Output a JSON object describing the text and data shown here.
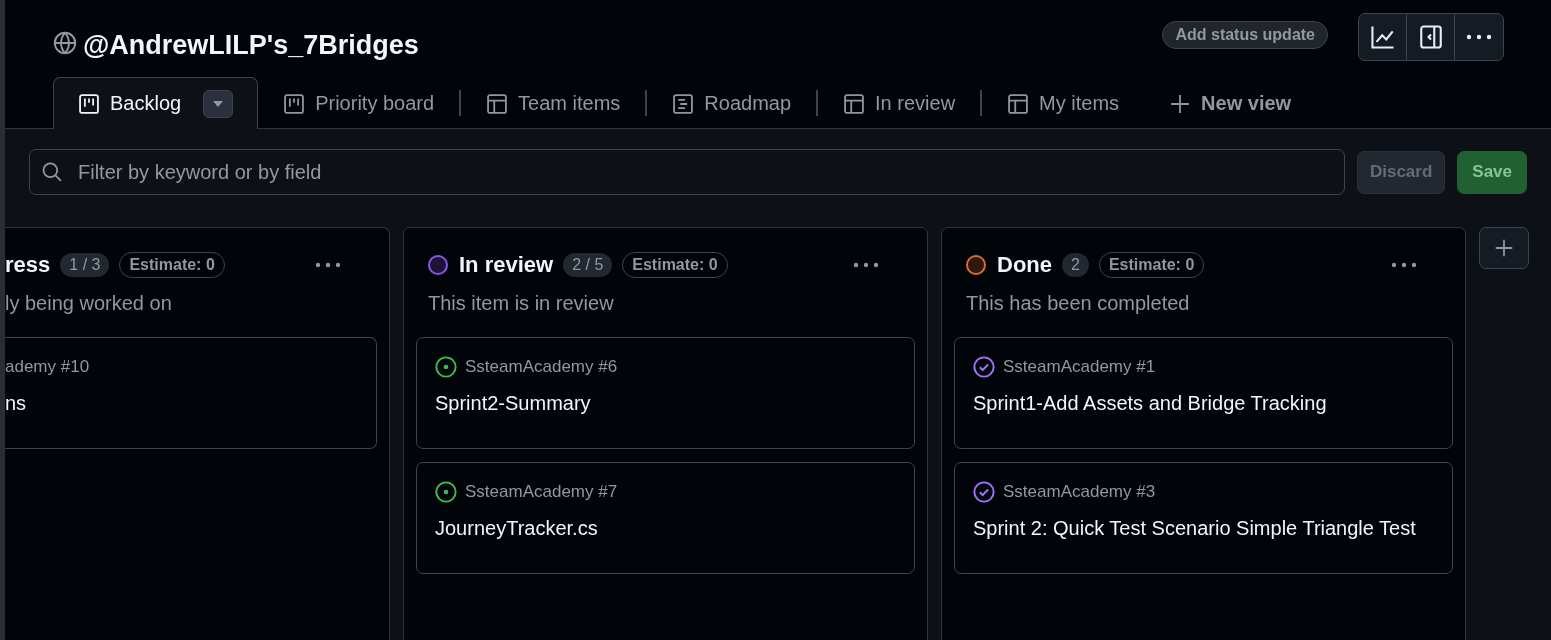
{
  "project": {
    "title": "@AndrewLILP's_7Bridges",
    "status_button": "Add status update"
  },
  "tabs": [
    {
      "label": "Backlog",
      "kind": "board",
      "selected": true
    },
    {
      "label": "Priority board",
      "kind": "board",
      "selected": false
    },
    {
      "label": "Team items",
      "kind": "table",
      "selected": false
    },
    {
      "label": "Roadmap",
      "kind": "roadmap",
      "selected": false
    },
    {
      "label": "In review",
      "kind": "table",
      "selected": false
    },
    {
      "label": "My items",
      "kind": "table",
      "selected": false
    }
  ],
  "new_view": "New view",
  "filter": {
    "placeholder": "Filter by keyword or by field",
    "discard": "Discard",
    "save": "Save"
  },
  "columns": [
    {
      "name": "ress",
      "count": "1 / 3",
      "estimate": "Estimate: 0",
      "description": "ly being worked on",
      "cards": [
        {
          "repo": "ademy #10",
          "title": "ns"
        }
      ]
    },
    {
      "name": "In review",
      "color": "#8957e5",
      "count": "2 / 5",
      "estimate": "Estimate: 0",
      "description": "This item is in review",
      "cards": [
        {
          "kind": "open",
          "repo": "SsteamAcademy #6",
          "title": "Sprint2-Summary"
        },
        {
          "kind": "open",
          "repo": "SsteamAcademy #7",
          "title": "JourneyTracker.cs"
        }
      ]
    },
    {
      "name": "Done",
      "color": "#db6d28",
      "count": "2",
      "estimate": "Estimate: 0",
      "description": "This has been completed",
      "cards": [
        {
          "kind": "done",
          "repo": "SsteamAcademy #1",
          "title": "Sprint1-Add Assets and Bridge Tracking"
        },
        {
          "kind": "done",
          "repo": "SsteamAcademy #3",
          "title": "Sprint 2: Quick Test Scenario Simple Triangle Test"
        }
      ]
    }
  ]
}
